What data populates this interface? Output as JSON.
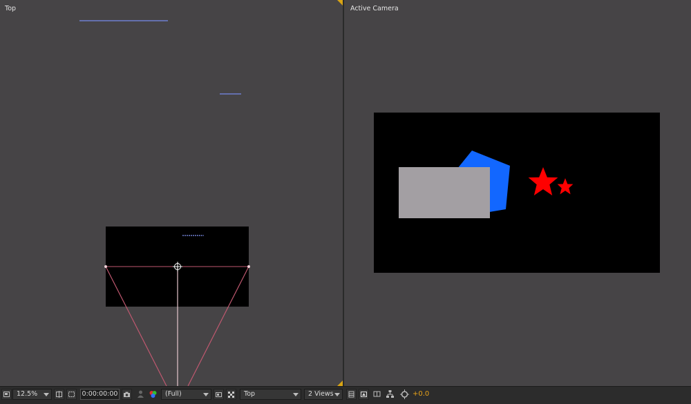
{
  "views": {
    "left": {
      "label": "Top"
    },
    "right": {
      "label": "Active Camera"
    }
  },
  "toolbar": {
    "zoom": "12.5%",
    "timecode": "0:00:00:00",
    "resolution": "(Full)",
    "view": "Top",
    "layout": "2 Views",
    "exposure": "+0.0"
  },
  "colors": {
    "accent": "#d9a414",
    "blue_shape": "#1267ff",
    "red_stars": "#ff0000",
    "gray_layer": "#a39fa3",
    "comp_bg": "#000000"
  },
  "icons": [
    "magnification-icon",
    "region-of-interest-icon",
    "safe-zones-icon",
    "snapshot-icon",
    "show-snapshot-icon",
    "channel-icon",
    "fast-previews-icon",
    "transparency-grid-icon",
    "view-options-icon",
    "3d-draft-icon",
    "flowchart-icon",
    "motion-blur-icon"
  ]
}
